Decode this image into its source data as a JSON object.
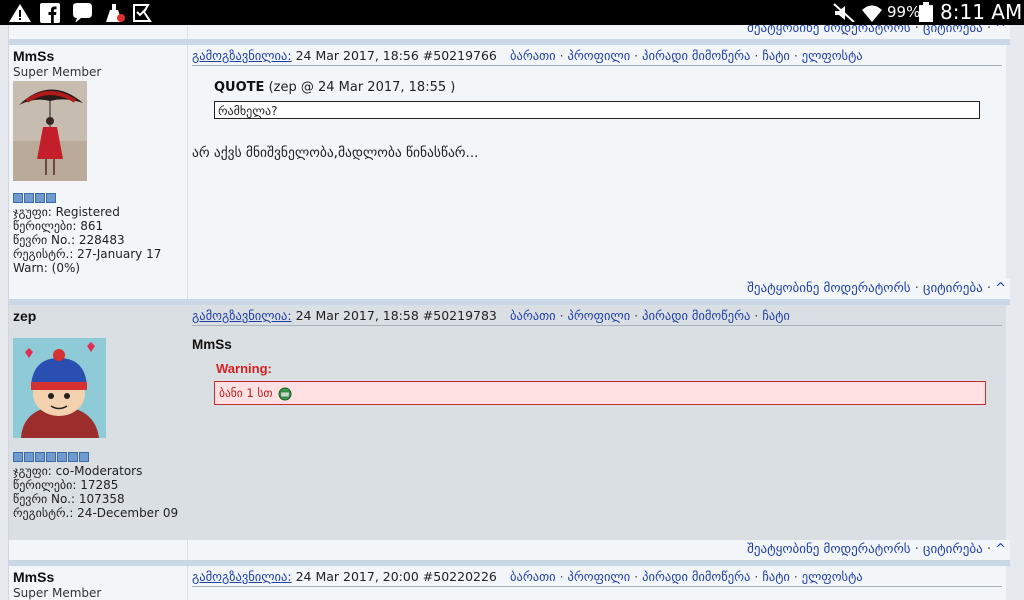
{
  "status_bar": {
    "battery": "99%",
    "time": "8:11 AM"
  },
  "top_footer": {
    "report": "შეატყობინე მოდერატორს",
    "quote": "ციტირება",
    "up": "^"
  },
  "posts": [
    {
      "username": "MmSs",
      "title": "Super Member",
      "meta": [
        "ჯგუფი: Registered",
        "წერილები: 861",
        "წევრი No.: 228483",
        "რეგისტრ.: 27-January 17",
        "Warn: (0%)"
      ],
      "posted_label": "გამოგზავნილია:",
      "date": "24 Mar 2017, 18:56",
      "post_id": "#50219766",
      "links": [
        "ბარათი",
        "პროფილი",
        "პირადი მიმოწერა",
        "ჩატი",
        "ელფოსტა"
      ],
      "quote_header": "QUOTE",
      "quote_source": "(zep @ 24 Mar 2017, 18:55 )",
      "quote_text": "რამხელა?",
      "body": "არ აქვს მნიშვნელობა,მადლობა წინასწარ..."
    },
    {
      "username": "zep",
      "meta": [
        "ჯგუფი: co-Moderators",
        "წერილები: 17285",
        "წევრი No.: 107358",
        "რეგისტრ.: 24-December 09"
      ],
      "posted_label": "გამოგზავნილია:",
      "date": "24 Mar 2017, 18:58",
      "post_id": "#50219783",
      "links": [
        "ბარათი",
        "პროფილი",
        "პირადი მიმოწერა",
        "ჩატი"
      ],
      "addressee": "MmSs",
      "warning_title": "Warning:",
      "warning_text": "ბანი 1 სთ"
    },
    {
      "username": "MmSs",
      "title": "Super Member",
      "posted_label": "გამოგზავნილია:",
      "date": "24 Mar 2017, 20:00",
      "post_id": "#50220226",
      "links": [
        "ბარათი",
        "პროფილი",
        "პირადი მიმოწერა",
        "ჩატი",
        "ელფოსტა"
      ]
    }
  ],
  "footer": {
    "report": "შეატყობინე მოდერატორს",
    "quote": "ციტირება",
    "up": "^"
  },
  "colors": {
    "link": "#1e3fa8",
    "warning": "#d62020",
    "warning_bg": "#ffe1e4",
    "status_bar": "#000000"
  }
}
